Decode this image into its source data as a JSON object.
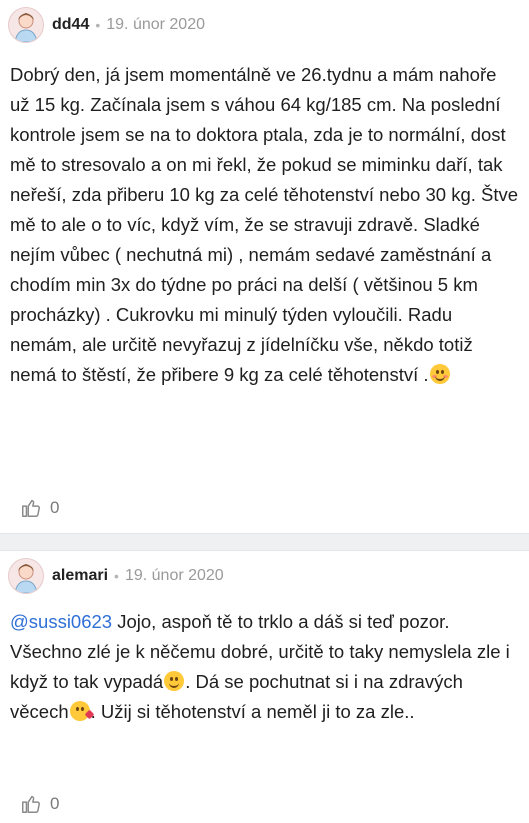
{
  "posts": [
    {
      "author": "dd44",
      "separator": "•",
      "date": "19. únor 2020",
      "text": "Dobrý den, já jsem momentálně ve 26.tydnu a mám nahoře už 15 kg. Začínala jsem s váhou 64 kg/185 cm. Na poslední kontrole jsem se na to doktora ptala, zda je to normální, dost mě to stresovalo a on mi řekl, že pokud se miminku daří, tak neřeší, zda přiberu 10 kg za celé těhotenství nebo 30 kg. Štve mě to ale o to víc, když vím, že se stravuji zdravě. Sladké nejím vůbec ( nechutná mi) , nemám sedavé zaměstnání a chodím min 3x do týdne po práci na delší ( většinou 5 km procházky) . Cukrovku mi minulý týden vyloučili. Radu nemám, ale určitě nevyřazuj z jídelníčku vše, někdo totiž nemá to štěstí, že přibere 9 kg za celé těhotenství .",
      "likes": "0",
      "icons": {
        "avatar": "avatar-icon",
        "emoji": "smiling-blush-emoji-icon",
        "like": "thumbs-up-icon"
      }
    },
    {
      "author": "alemari",
      "separator": "•",
      "date": "19. únor 2020",
      "mention": "@sussi0623",
      "text_part1": " Jojo, aspoň tě to trklo a dáš si teď pozor. Všechno zlé je k něčemu dobré, určitě to taky nemyslela zle i když to tak vypadá",
      "text_part2": ". Dá se pochutnat si i na zdravých věcech",
      "text_part3": ". Užij si těhotenství a neměl ji to za zle..",
      "likes": "0",
      "icons": {
        "avatar": "avatar-icon",
        "emoji1": "slightly-smiling-emoji-icon",
        "emoji2": "face-blowing-kiss-emoji-icon",
        "like": "thumbs-up-icon"
      }
    }
  ],
  "colors": {
    "mention": "#2f6fd6",
    "separator_bg": "#eef0f2",
    "date": "#9a9a9a",
    "likes": "#7a7a7a"
  }
}
